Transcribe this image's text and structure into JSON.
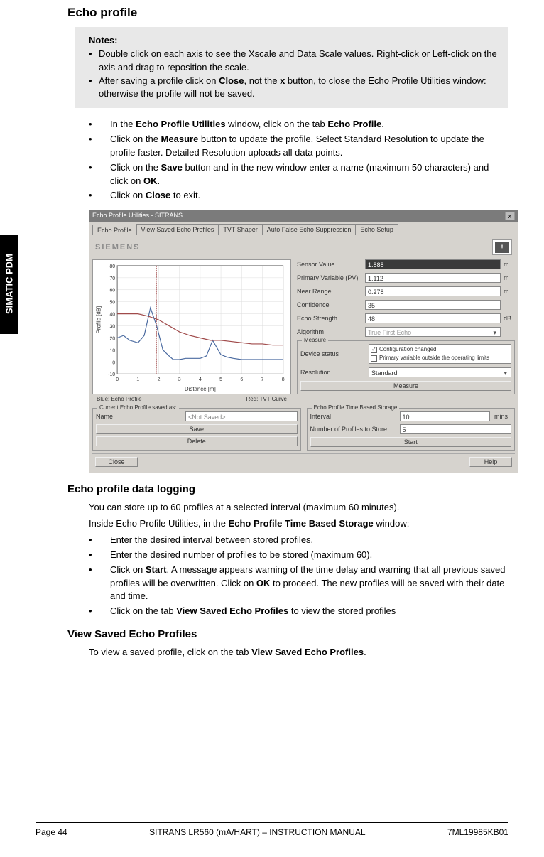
{
  "side_tab": "SIMATIC PDM",
  "h_echo_profile": "Echo profile",
  "notes": {
    "title": "Notes:",
    "items": [
      "Double click on each axis to see the Xscale and Data Scale values. Right-click or Left-click on the axis and drag to reposition the scale.",
      "After saving a profile click on <b>Close</b>, not the <b>x</b> button, to close the Echo Profile Utilities window: otherwise the profile will not be saved."
    ]
  },
  "list1": [
    "In the <b>Echo Profile Utilities</b> window, click on the tab <b>Echo Profile</b>.",
    "Click on the <b>Measure</b> button to update the profile. Select Standard Resolution to update the profile faster. Detailed Resolution uploads all data points.",
    "Click on the <b>Save</b> button and in the new window enter a name (maximum 50 characters) and click on <b>OK</b>.",
    "Click on <b>Close</b> to exit."
  ],
  "win": {
    "title": "Echo Profile Utilities - SITRANS",
    "tabs": [
      "Echo Profile",
      "View Saved Echo Profiles",
      "TVT Shaper",
      "Auto False Echo Suppression",
      "Echo Setup"
    ],
    "logo": "SIEMENS",
    "chart": {
      "ylabel": "Profile [dB]",
      "xlabel": "Distance [m]",
      "yticks": [
        "-10",
        "0",
        "10",
        "20",
        "30",
        "40",
        "50",
        "60",
        "70",
        "80"
      ],
      "xticks": [
        "0",
        "1",
        "2",
        "3",
        "4",
        "5",
        "6",
        "7",
        "8"
      ]
    },
    "legend": {
      "left": "Blue: Echo Profile",
      "right": "Red: TVT Curve"
    },
    "fields": {
      "sensor_value": {
        "label": "Sensor Value",
        "value": "1.888",
        "unit": "m"
      },
      "pv": {
        "label": "Primary Variable (PV)",
        "value": "1.112",
        "unit": "m"
      },
      "near_range": {
        "label": "Near Range",
        "value": "0.278",
        "unit": "m"
      },
      "confidence": {
        "label": "Confidence",
        "value": "35",
        "unit": ""
      },
      "echo_strength": {
        "label": "Echo Strength",
        "value": "48",
        "unit": "dB"
      },
      "algorithm": {
        "label": "Algorithm",
        "value": "True First Echo",
        "unit": ""
      }
    },
    "measure_group": {
      "label": "Measure",
      "device_status_label": "Device status",
      "device_status_1": "Configuration changed",
      "device_status_2": "Primary variable outside the operating limits",
      "resolution_label": "Resolution",
      "resolution_value": "Standard",
      "measure_btn": "Measure"
    },
    "saved_group": {
      "label": "Current Echo Profile saved as:",
      "name_label": "Name",
      "name_value": "<Not Saved>",
      "save_btn": "Save",
      "delete_btn": "Delete"
    },
    "storage_group": {
      "label": "Echo Profile Time Based Storage",
      "interval_label": "Interval",
      "interval_value": "10",
      "interval_unit": "mins",
      "num_label": "Number of Profiles to Store",
      "num_value": "5",
      "start_btn": "Start"
    },
    "close_btn": "Close",
    "help_btn": "Help"
  },
  "h_logging": "Echo profile data logging",
  "logging_intro1": "You can store up to 60 profiles at a selected interval (maximum 60 minutes).",
  "logging_intro2": "Inside Echo Profile Utilities, in the <b>Echo Profile Time Based Storage</b> window:",
  "list2": [
    "Enter the desired interval between stored profiles.",
    "Enter the desired number of profiles to be stored (maximum 60).",
    "Click on <b>Start</b>. A message appears warning of the time delay and warning that all previous saved profiles will be overwritten. Click on <b>OK</b> to proceed. The new profiles will be saved with their date and time.",
    "Click on the tab <b>View Saved Echo Profiles</b> to view the stored profiles"
  ],
  "h_view": "View Saved Echo Profiles",
  "view_para": "To view a saved profile, click on the tab <b>View Saved Echo Profiles</b>.",
  "footer": {
    "left": "Page 44",
    "center": "SITRANS LR560 (mA/HART) – INSTRUCTION MANUAL",
    "right": "7ML19985KB01"
  },
  "chart_data": {
    "type": "line",
    "xlabel": "Distance [m]",
    "ylabel": "Profile [dB]",
    "xlim": [
      0,
      8
    ],
    "ylim": [
      -10,
      80
    ],
    "series": [
      {
        "name": "Echo Profile",
        "color": "blue",
        "x": [
          0.0,
          0.3,
          0.6,
          1.0,
          1.3,
          1.6,
          1.9,
          2.2,
          2.5,
          2.7,
          3.0,
          3.3,
          3.6,
          4.0,
          4.3,
          4.6,
          5.0,
          5.3,
          5.6,
          6.0,
          6.3,
          6.6,
          7.0,
          7.3,
          7.6,
          8.0
        ],
        "y": [
          20,
          22,
          18,
          16,
          22,
          45,
          30,
          10,
          5,
          2,
          2,
          3,
          3,
          3,
          5,
          18,
          6,
          4,
          3,
          2,
          2,
          2,
          2,
          2,
          2,
          2
        ]
      },
      {
        "name": "TVT Curve",
        "color": "red",
        "x": [
          0.0,
          0.5,
          1.0,
          1.5,
          2.0,
          2.5,
          3.0,
          3.5,
          4.0,
          4.5,
          5.0,
          5.5,
          6.0,
          6.5,
          7.0,
          7.5,
          8.0
        ],
        "y": [
          40,
          40,
          40,
          38,
          35,
          30,
          25,
          22,
          20,
          18,
          18,
          17,
          16,
          15,
          15,
          14,
          14
        ]
      }
    ],
    "marker_x": 1.888
  }
}
